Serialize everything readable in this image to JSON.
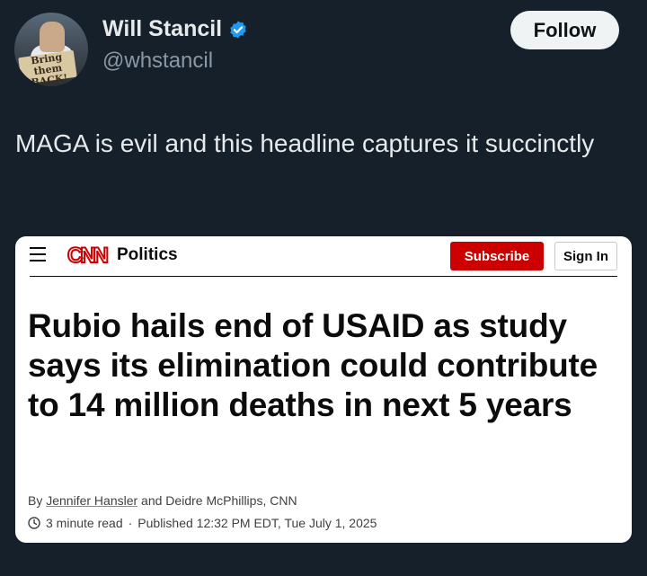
{
  "tweet": {
    "display_name": "Will Stancil",
    "handle": "@whstancil",
    "follow_label": "Follow",
    "text": "MAGA is evil and this headline captures it succinctly",
    "avatar_sign_text": "Bring them BACK!",
    "verified_icon": "verified-badge-icon",
    "accent_color": "#1d9bf0"
  },
  "card": {
    "brand": "CNN",
    "section": "Politics",
    "subscribe_label": "Subscribe",
    "signin_label": "Sign In",
    "headline": "Rubio hails end of USAID as study says its elimination could contribute to 14 million deaths in next 5 years",
    "byline_prefix": "By ",
    "author_1": "Jennifer Hansler",
    "byline_join": " and Deidre McPhillips, CNN",
    "read_time": "3 minute read",
    "published": "Published 12:32 PM EDT, Tue July 1, 2025",
    "brand_color": "#cc0000"
  }
}
